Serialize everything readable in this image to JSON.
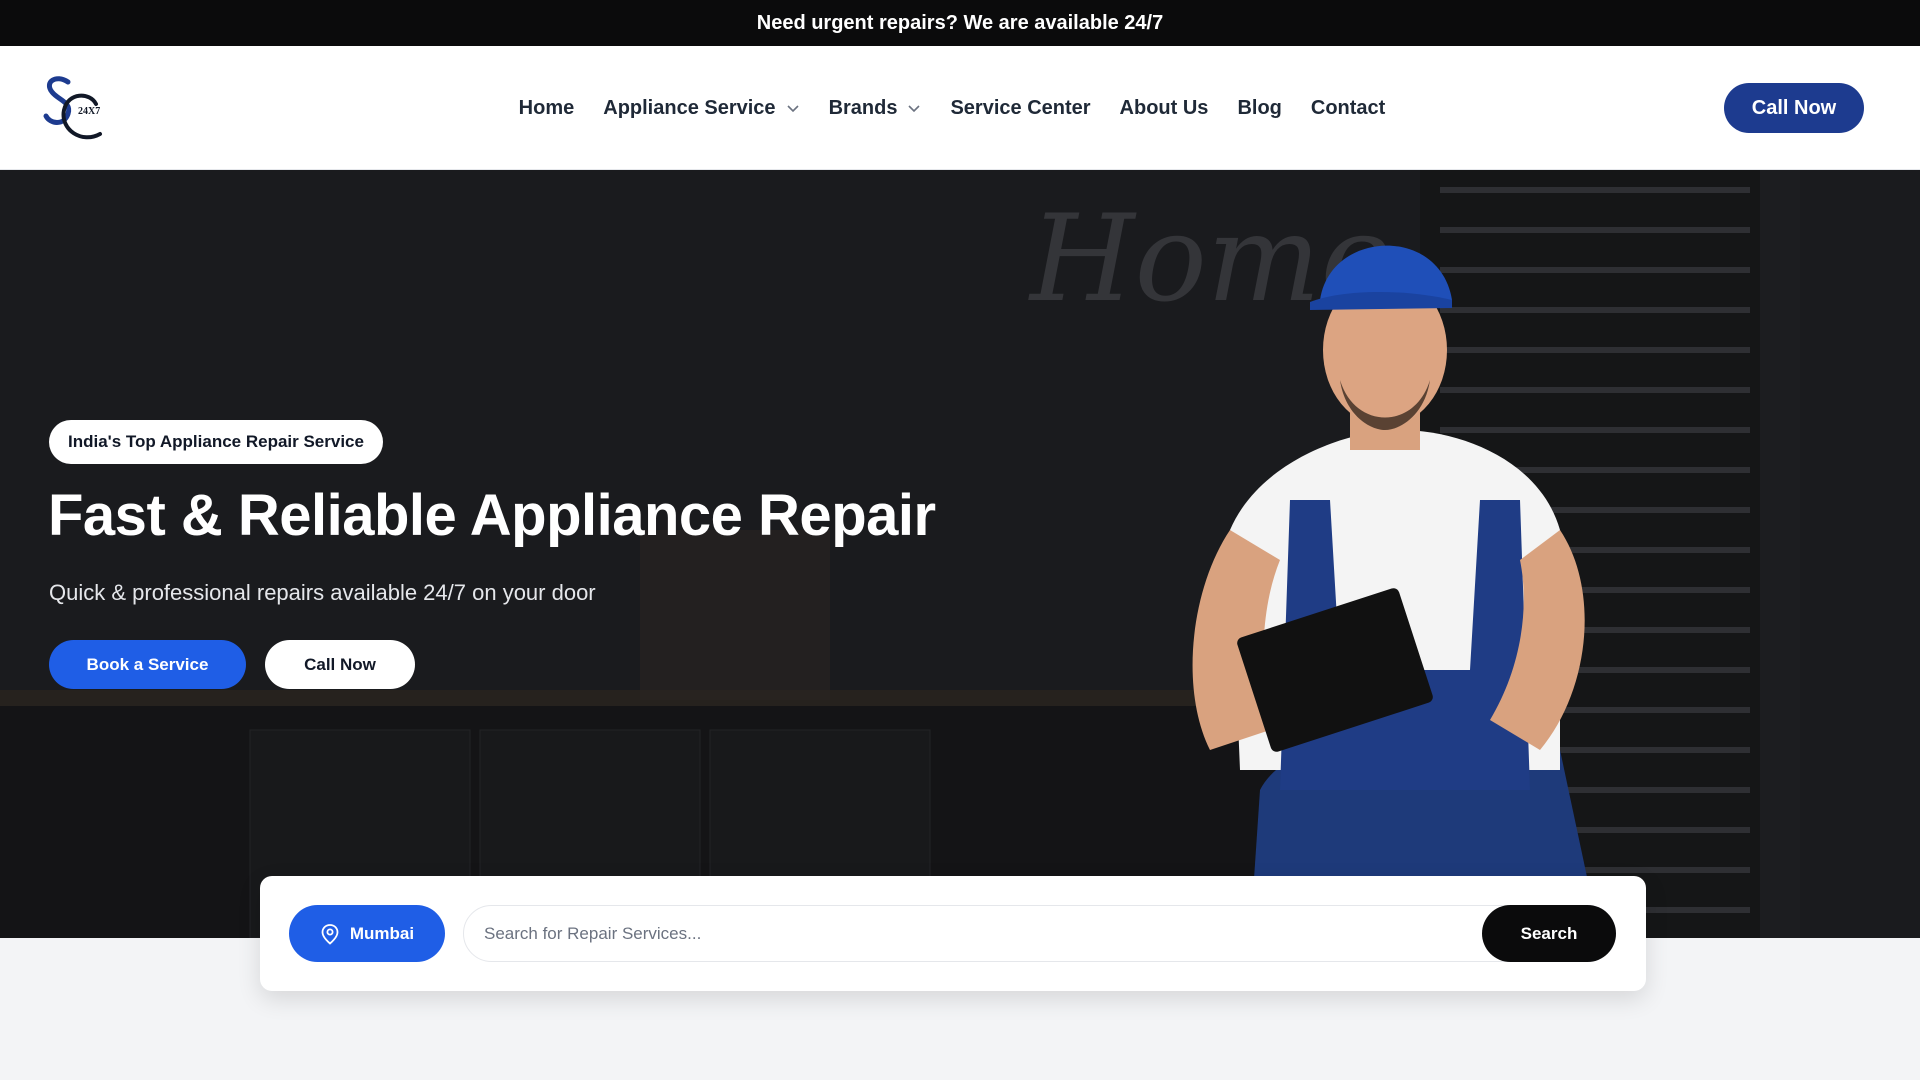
{
  "topbar": {
    "text": "Need urgent repairs? We are available 24/7"
  },
  "header": {
    "logo_text": "SC 24X7",
    "nav": [
      {
        "label": "Home",
        "has_dropdown": false
      },
      {
        "label": "Appliance Service",
        "has_dropdown": true
      },
      {
        "label": "Brands",
        "has_dropdown": true
      },
      {
        "label": "Service Center",
        "has_dropdown": false
      },
      {
        "label": "About Us",
        "has_dropdown": false
      },
      {
        "label": "Blog",
        "has_dropdown": false
      },
      {
        "label": "Contact",
        "has_dropdown": false
      }
    ],
    "call_label": "Call Now"
  },
  "hero": {
    "badge": "India's Top Appliance Repair Service",
    "title": "Fast & Reliable Appliance Repair",
    "subtitle": "Quick & professional repairs available 24/7 on your door",
    "book_label": "Book a Service",
    "call_label": "Call Now",
    "wall_text": "Home"
  },
  "search": {
    "city": "Mumbai",
    "placeholder": "Search for Repair Services...",
    "button_label": "Search"
  },
  "colors": {
    "primary_blue": "#1f5ee6",
    "navy": "#1d3b8f",
    "dark": "#0b0b0c"
  }
}
